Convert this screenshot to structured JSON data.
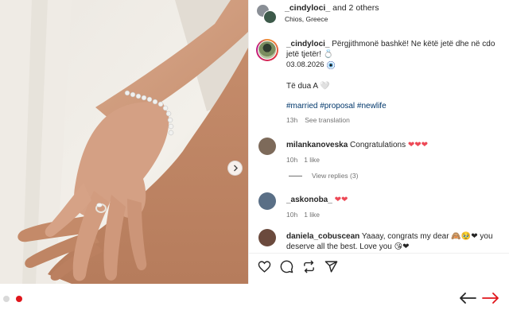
{
  "post": {
    "header": {
      "username": "_cindyloci_",
      "collab_suffix": " and 2 others",
      "location": "Chios, Greece"
    },
    "caption": {
      "username": "_cindyloci_",
      "text": " Përgjithmonë bashkë! Ne këtë jetë dhe në cdo jetë tjetër! 💍",
      "date": "03.08.2026",
      "note": "Të dua A 🤍",
      "hashtags": "#married #proposal #newlife",
      "time": "13h",
      "see_translation": "See translation"
    },
    "comments": [
      {
        "username": "milankanoveska",
        "text": " Congratulations ",
        "hearts": "❤❤❤",
        "time": "10h",
        "likes": "1 like",
        "avatar_color": "#7d6a5a"
      },
      {
        "username": "_askonoba_",
        "text": " ",
        "hearts": "❤❤",
        "time": "10h",
        "likes": "1 like",
        "avatar_color": "#5a6f86"
      },
      {
        "username": "daniela_cobuscean",
        "text": " Yaaay, congrats my dear 🙈🥹❤ you deserve all the best. Love you 😘❤",
        "avatar_color": "#6b4a3d"
      }
    ],
    "view_replies": "View replies (3)"
  },
  "navigation": {
    "dots": [
      "inactive",
      "active"
    ],
    "dot_colors": {
      "active": "#e0161c",
      "inactive": "#d9d9d9"
    },
    "prev_color": "#262626",
    "next_color": "#e0161c"
  },
  "icons": [
    "heart-icon",
    "comment-icon",
    "share-icon",
    "send-icon",
    "chevron-right-icon",
    "arrow-left-icon",
    "arrow-right-icon",
    "evil-eye-icon"
  ]
}
